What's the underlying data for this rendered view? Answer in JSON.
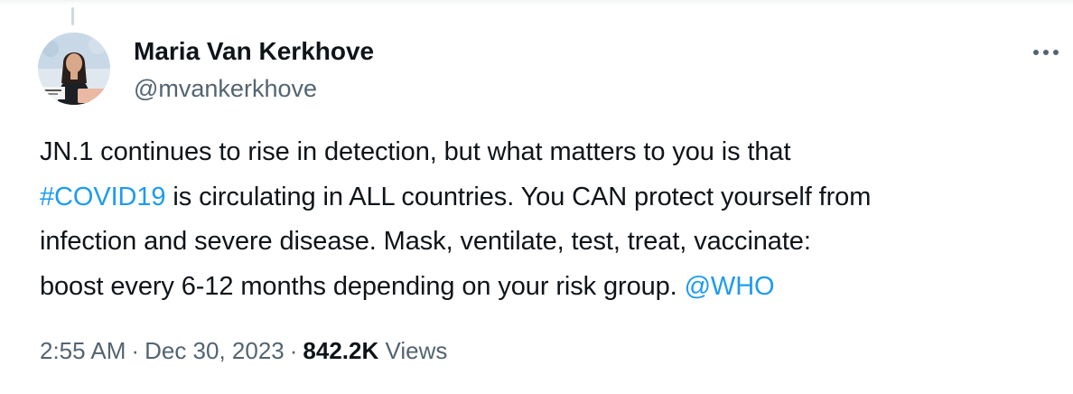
{
  "author": {
    "display_name": "Maria Van Kerkhove",
    "handle": "@mvankerkhove"
  },
  "tweet": {
    "lines": [
      [
        {
          "text": "JN.1 continues to rise in detection, but what matters to you is that",
          "link": false
        }
      ],
      [
        {
          "text": "#COVID19",
          "link": true
        },
        {
          "text": " is circulating in ALL countries. You CAN protect yourself from",
          "link": false
        }
      ],
      [
        {
          "text": "infection and severe disease. Mask, ventilate, test, treat, vaccinate:",
          "link": false
        }
      ],
      [
        {
          "text": "boost every 6-12 months depending on your risk group. ",
          "link": false
        },
        {
          "text": "@WHO",
          "link": true
        }
      ]
    ]
  },
  "meta": {
    "time": "2:55 AM",
    "separator": "·",
    "date": "Dec 30, 2023",
    "views_count": "842.2K",
    "views_label": "Views"
  },
  "icons": {
    "more": "more-dots-icon",
    "avatar": "profile-photo"
  },
  "colors": {
    "link": "#1d9bf0",
    "text": "#0f1419",
    "secondary": "#536471"
  }
}
